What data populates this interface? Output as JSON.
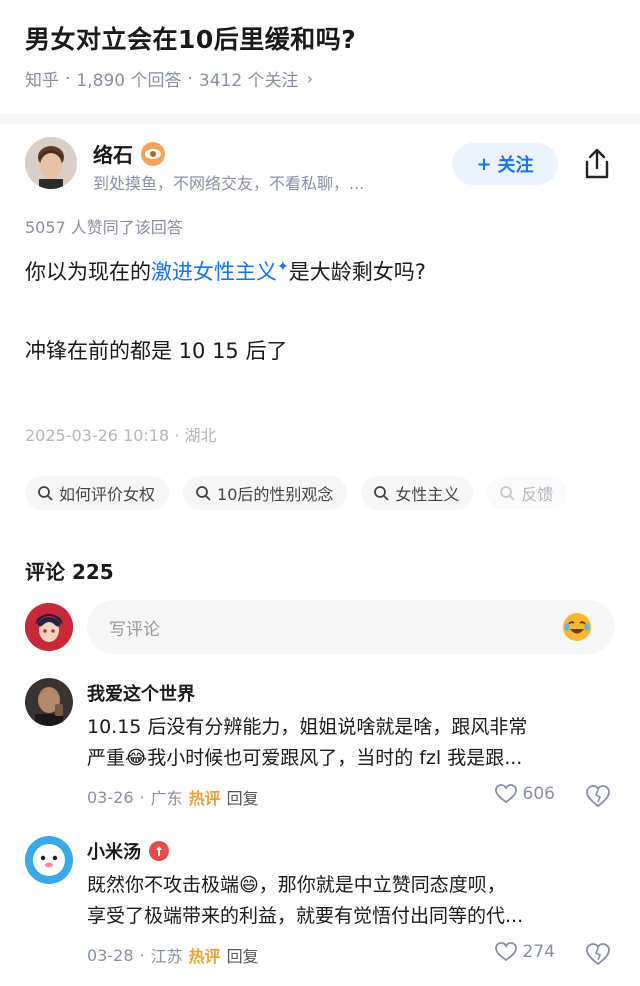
{
  "question": {
    "title": "男女对立会在10后里缓和吗?",
    "source": "知乎",
    "answers": "1,890 个回答",
    "followers": "3412 个关注",
    "dot": "·",
    "chevron": "›"
  },
  "author": {
    "name": "络石",
    "bio": "到处摸鱼，不网络交友，不看私聊，...",
    "follow_label": "关注",
    "follow_plus": "+"
  },
  "answer": {
    "upvotes": "5057 人赞同了该回答",
    "line1_before": "你以为现在的",
    "line1_link": "激进女性主义",
    "line1_spark": "✦",
    "line1_after": "是大龄剩女吗?",
    "line2": "冲锋在前的都是 10 15 后了",
    "time": "2025-03-26 10:18 · 湖北"
  },
  "chips": [
    "如何评价女权",
    "10后的性别观念",
    "女性主义",
    "反馈"
  ],
  "comments_section": {
    "title": "评论 225",
    "input_placeholder": "写评论"
  },
  "comments": [
    {
      "name": "我爱这个世界",
      "line1": "10.15 后没有分辨能力，姐姐说啥就是啥，跟风非常",
      "line2": "严重😂我小时候也可爱跟风了，当时的 fzl 我是跟...",
      "date": "03-26",
      "location": "广东",
      "hot": "热评",
      "reply": "回复",
      "likes": "606"
    },
    {
      "name": "小米汤",
      "line1": "既然你不攻击极端😄，那你就是中立赞同态度呗，",
      "line2": "享受了极端带来的利益，就要有觉悟付出同等的代...",
      "date": "03-28",
      "location": "江苏",
      "hot": "热评",
      "reply": "回复",
      "likes": "274"
    }
  ],
  "colors": {
    "accent": "#1772f6",
    "muted": "#8590a6",
    "hot": "#e9a23b"
  }
}
